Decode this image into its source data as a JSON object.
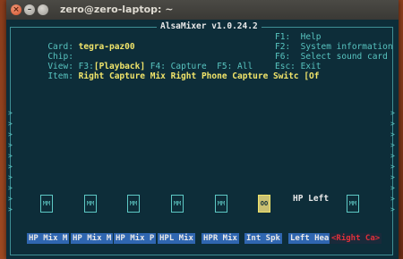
{
  "window": {
    "title": "zero@zero-laptop: ~"
  },
  "app": {
    "title": "AlsaMixer v1.0.24.2"
  },
  "info": {
    "card_label": "Card:",
    "card_value": "tegra-paz00",
    "chip_label": "Chip:",
    "chip_value": "",
    "view_label": "View:",
    "view_f3": "F3:",
    "view_playback": "[Playback]",
    "view_f4": "F4: Capture",
    "view_f5": "F5: All",
    "item_label": "Item:",
    "item_value": "Right Capture Mix Right Phone Capture Switc [Of"
  },
  "help": [
    {
      "key": "F1:",
      "text": "Help"
    },
    {
      "key": "F2:",
      "text": "System information"
    },
    {
      "key": "F6:",
      "text": "Select sound card"
    },
    {
      "key": "Esc:",
      "text": "Exit"
    }
  ],
  "selected_control": "HP Left",
  "controls": [
    {
      "mark": "MM"
    },
    {
      "mark": "MM"
    },
    {
      "mark": "MM"
    },
    {
      "mark": "MM"
    },
    {
      "mark": "MM"
    },
    {
      "mark": "MM"
    },
    {
      "mark": "OO"
    },
    {
      "mark": "MM"
    }
  ],
  "tabs": [
    "HP Mix M",
    "HP Mix M",
    "HP Mix P",
    "HPL Mix",
    "HPR Mix",
    "Int Spk",
    "Left Hea",
    "<Right Ca>"
  ],
  "arrow_glyph": ">"
}
